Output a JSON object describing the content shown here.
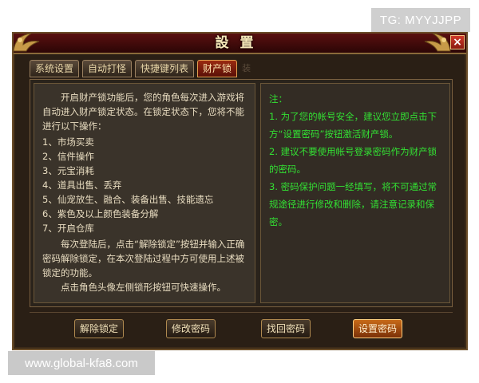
{
  "watermarks": {
    "tg": "TG: MYYJJPP",
    "url": "www.global-kfa8.com"
  },
  "window": {
    "title": "設置",
    "close_label": "×"
  },
  "tabs": [
    {
      "label": "系统设置",
      "active": false
    },
    {
      "label": "自动打怪",
      "active": false
    },
    {
      "label": "快捷键列表",
      "active": false
    },
    {
      "label": "财产锁",
      "active": true
    }
  ],
  "tab_extra": "装",
  "left_panel": {
    "intro": "开启财产锁功能后，您的角色每次进入游戏将自动进入财产锁定状态。在锁定状态下，您将不能进行以下操作：",
    "operations": [
      "1、市场买卖",
      "2、信件操作",
      "3、元宝消耗",
      "4、道具出售、丢弃",
      "5、仙宠放生、融合、装备出售、技能遗忘",
      "6、紫色及以上颜色装备分解",
      "7、开启仓库"
    ],
    "paragraph1": "每次登陆后，点击“解除锁定”按钮并输入正确密码解除锁定，在本次登陆过程中方可使用上述被锁定的功能。",
    "paragraph2": "点击角色头像左侧锁形按钮可快速操作。"
  },
  "right_panel": {
    "title": "注：",
    "notes": [
      "1. 为了您的帐号安全，建议您立即点击下方“设置密码”按钮激活财产锁。",
      "2. 建议不要使用帐号登录密码作为财产锁的密码。",
      "3. 密码保护问题一经填写，将不可通过常规途径进行修改和删除，请注意记录和保密。"
    ]
  },
  "buttons": {
    "unlock": "解除锁定",
    "change_password": "修改密码",
    "recover_password": "找回密码",
    "set_password": "设置密码"
  }
}
